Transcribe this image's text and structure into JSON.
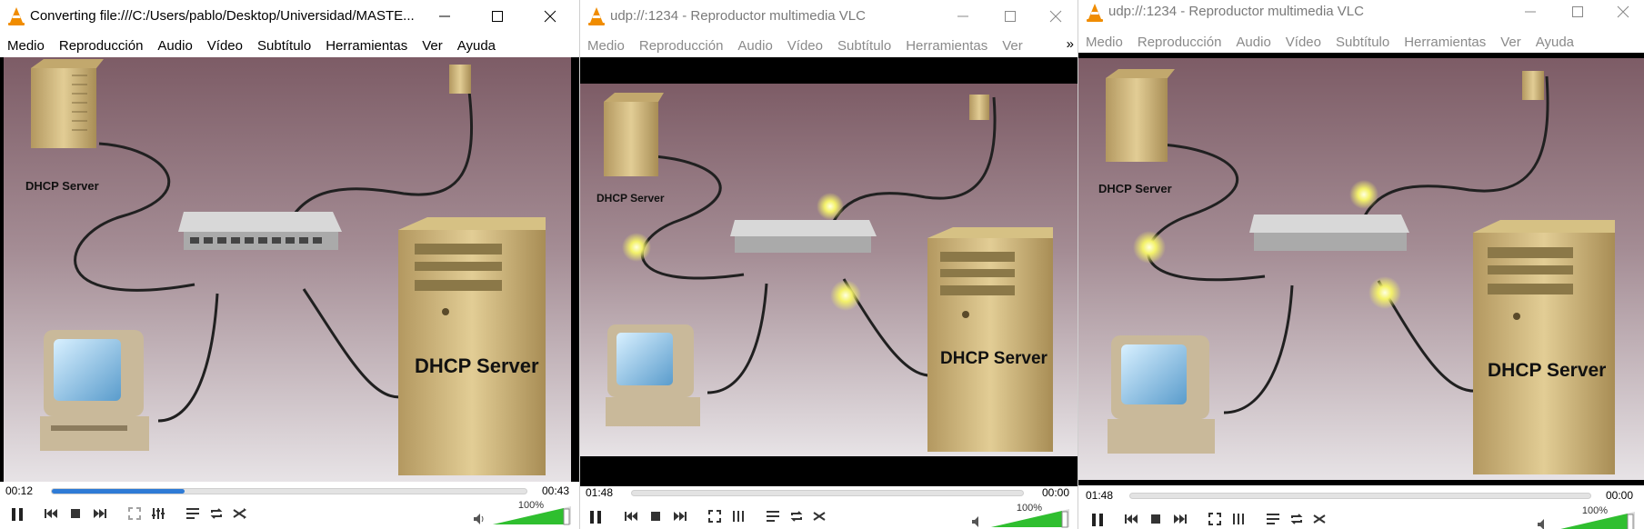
{
  "windows": [
    {
      "id": "converting",
      "title": "Converting file:///C:/Users/pablo/Desktop/Universidad/MASTE...",
      "active": true,
      "menu": [
        "Medio",
        "Reproducción",
        "Audio",
        "Vídeo",
        "Subtítulo",
        "Herramientas",
        "Ver",
        "Ayuda"
      ],
      "video": {
        "server_small_label": "DHCP Server",
        "server_large_label": "DHCP Server"
      },
      "elapsed": "00:12",
      "total": "00:43",
      "progress": 0.28,
      "volume": "100%"
    },
    {
      "id": "udp-1",
      "title": "udp://:1234 - Reproductor multimedia VLC",
      "active": false,
      "menu": [
        "Medio",
        "Reproducción",
        "Audio",
        "Vídeo",
        "Subtítulo",
        "Herramientas",
        "Ver"
      ],
      "menu_overflow": "»",
      "video": {
        "server_small_label": "DHCP Server",
        "server_large_label": "DHCP Server"
      },
      "elapsed": "01:48",
      "total": "00:00",
      "progress": 0,
      "volume": "100%"
    },
    {
      "id": "udp-2",
      "title": "udp://:1234 - Reproductor multimedia VLC",
      "active": false,
      "menu": [
        "Medio",
        "Reproducción",
        "Audio",
        "Vídeo",
        "Subtítulo",
        "Herramientas",
        "Ver",
        "Ayuda"
      ],
      "video": {
        "server_small_label": "DHCP Server",
        "server_large_label": "DHCP Server"
      },
      "elapsed": "01:48",
      "total": "00:00",
      "progress": 0,
      "volume": "100%"
    }
  ],
  "icons": {
    "app": "vlc-cone-icon",
    "minimize": "minimize-icon",
    "maximize": "maximize-icon",
    "close": "close-icon",
    "pause": "pause-icon",
    "previous": "previous-icon",
    "stop": "stop-icon",
    "next": "next-icon",
    "fullscreen": "fullscreen-icon",
    "extended": "equalizer-icon",
    "playlist": "playlist-icon",
    "loop": "loop-icon",
    "random": "shuffle-icon",
    "volume": "speaker-icon"
  },
  "colors": {
    "accent": "#2e7bd6",
    "volume": "#2fbf2f",
    "vlc_orange": "#f08c00"
  }
}
